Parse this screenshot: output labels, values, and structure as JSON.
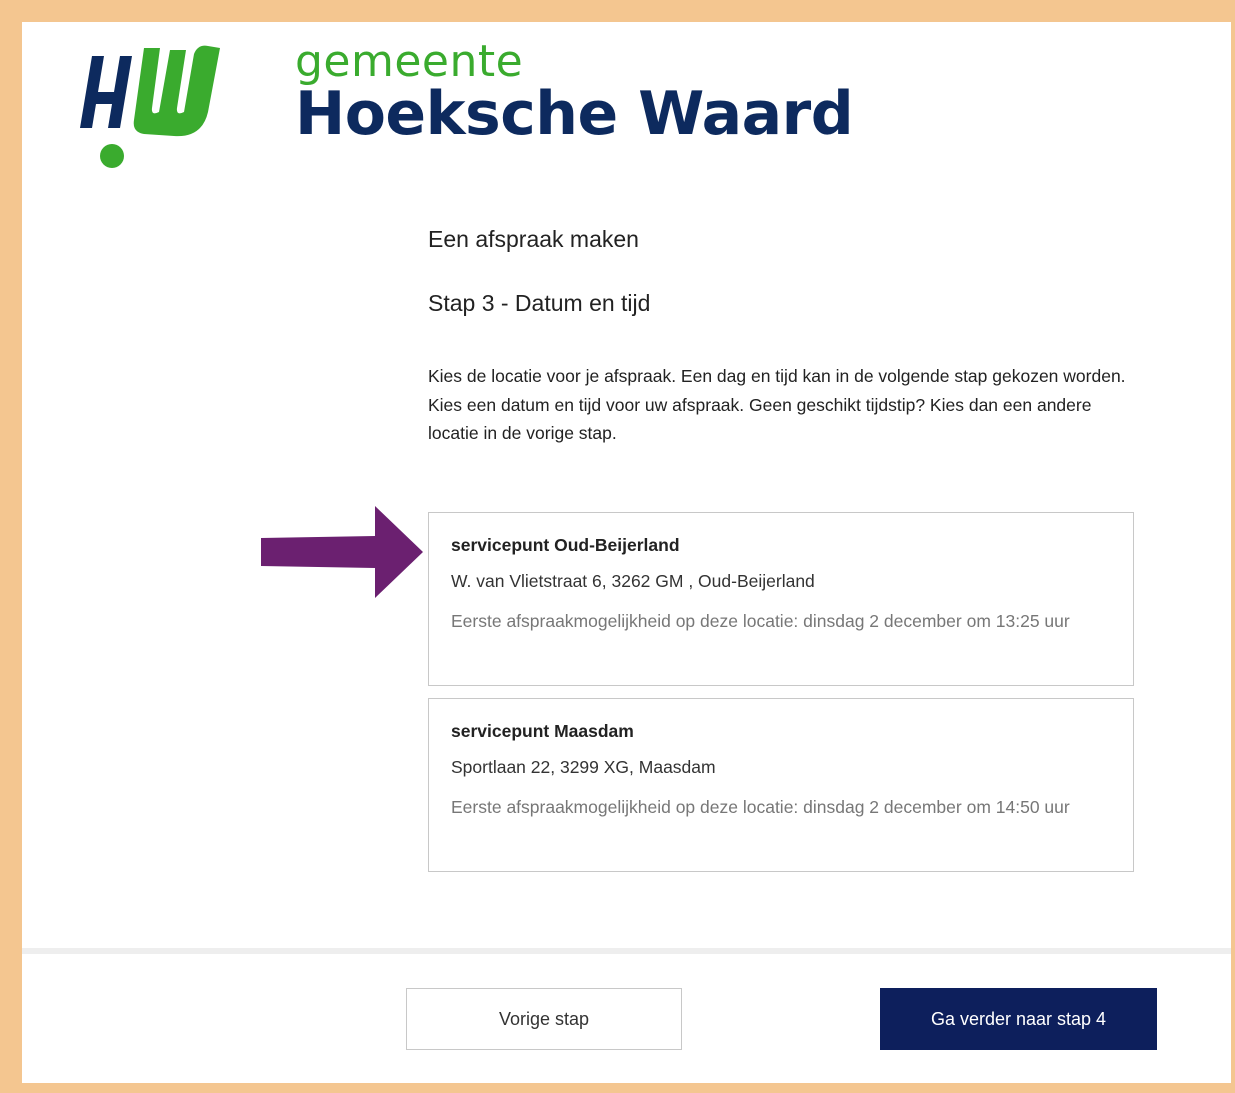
{
  "header": {
    "brand_small": "gemeente",
    "brand_name": "Hoeksche Waard",
    "logo_icon": "hw-logo-icon"
  },
  "page": {
    "title": "Een afspraak maken",
    "step_title": "Stap 3 - Datum en tijd",
    "intro": "Kies de locatie voor je afspraak. Een dag en tijd kan in de volgende stap gekozen worden. Kies een datum en tijd voor uw afspraak. Geen geschikt tijdstip? Kies dan een andere locatie in de vorige stap."
  },
  "locations": [
    {
      "name": "servicepunt Oud-Beijerland",
      "address": "W. van Vlietstraat 6, 3262 GM , Oud-Beijerland",
      "availability": "Eerste afspraakmogelijkheid op deze locatie: dinsdag 2 december om 13:25 uur"
    },
    {
      "name": "servicepunt Maasdam",
      "address": "Sportlaan 22, 3299 XG, Maasdam",
      "availability": "Eerste afspraakmogelijkheid op deze locatie: dinsdag 2 december om 14:50 uur"
    }
  ],
  "footer": {
    "prev_label": "Vorige stap",
    "next_label": "Ga verder naar stap 4"
  },
  "colors": {
    "border": "#f4c690",
    "brand_green": "#3aab2e",
    "brand_navy": "#0d2a5e",
    "button_primary": "#0d1f5c",
    "arrow": "#6b2070"
  }
}
